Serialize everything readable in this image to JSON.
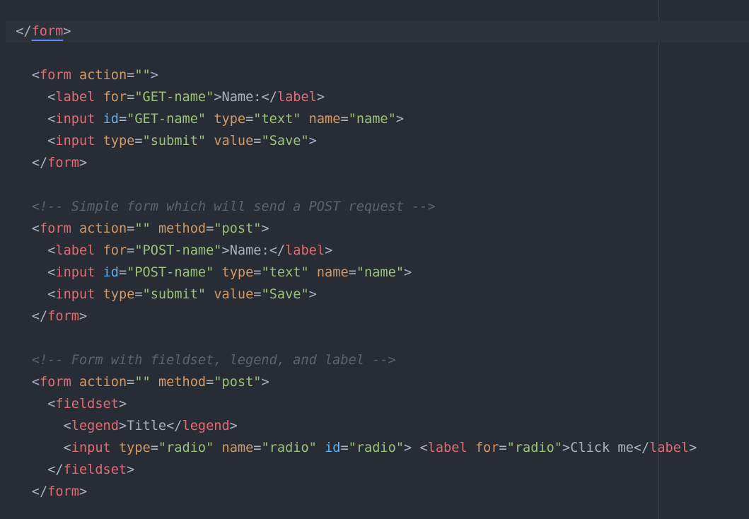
{
  "editor": {
    "colors": {
      "background": "#282c34",
      "current_line": "#2c313a",
      "punctuation": "#abb2bf",
      "tag": "#e06c75",
      "attribute": "#d19a66",
      "id_attribute": "#61afef",
      "string": "#98c379",
      "comment": "#5c6370",
      "bracket_match_underline": "#528bff"
    },
    "lines": [
      {
        "current": true,
        "tokens": [
          [
            "punc",
            "  </"
          ],
          [
            "tag",
            "form",
            "matched"
          ],
          [
            "punc",
            ">"
          ]
        ]
      },
      {
        "tokens": []
      },
      {
        "tokens": [
          [
            "punc",
            "    <"
          ],
          [
            "tag",
            "form"
          ],
          [
            "text",
            " "
          ],
          [
            "attr",
            "action"
          ],
          [
            "punc",
            "="
          ],
          [
            "str",
            "\"\""
          ],
          [
            "punc",
            ">"
          ]
        ]
      },
      {
        "tokens": [
          [
            "punc",
            "      <"
          ],
          [
            "tag",
            "label"
          ],
          [
            "text",
            " "
          ],
          [
            "attr",
            "for"
          ],
          [
            "punc",
            "="
          ],
          [
            "str",
            "\"GET-name\""
          ],
          [
            "punc",
            ">"
          ],
          [
            "text",
            "Name:"
          ],
          [
            "punc",
            "</"
          ],
          [
            "tag",
            "label"
          ],
          [
            "punc",
            ">"
          ]
        ]
      },
      {
        "tokens": [
          [
            "punc",
            "      <"
          ],
          [
            "tag",
            "input"
          ],
          [
            "text",
            " "
          ],
          [
            "id",
            "id"
          ],
          [
            "punc",
            "="
          ],
          [
            "str",
            "\"GET-name\""
          ],
          [
            "text",
            " "
          ],
          [
            "attr",
            "type"
          ],
          [
            "punc",
            "="
          ],
          [
            "str",
            "\"text\""
          ],
          [
            "text",
            " "
          ],
          [
            "attr",
            "name"
          ],
          [
            "punc",
            "="
          ],
          [
            "str",
            "\"name\""
          ],
          [
            "punc",
            ">"
          ]
        ]
      },
      {
        "tokens": [
          [
            "punc",
            "      <"
          ],
          [
            "tag",
            "input"
          ],
          [
            "text",
            " "
          ],
          [
            "attr",
            "type"
          ],
          [
            "punc",
            "="
          ],
          [
            "str",
            "\"submit\""
          ],
          [
            "text",
            " "
          ],
          [
            "attr",
            "value"
          ],
          [
            "punc",
            "="
          ],
          [
            "str",
            "\"Save\""
          ],
          [
            "punc",
            ">"
          ]
        ]
      },
      {
        "tokens": [
          [
            "punc",
            "    </"
          ],
          [
            "tag",
            "form"
          ],
          [
            "punc",
            ">"
          ]
        ]
      },
      {
        "tokens": []
      },
      {
        "tokens": [
          [
            "comment",
            "    <!-- Simple form which will send a POST request -->"
          ]
        ]
      },
      {
        "tokens": [
          [
            "punc",
            "    <"
          ],
          [
            "tag",
            "form"
          ],
          [
            "text",
            " "
          ],
          [
            "attr",
            "action"
          ],
          [
            "punc",
            "="
          ],
          [
            "str",
            "\"\""
          ],
          [
            "text",
            " "
          ],
          [
            "attr",
            "method"
          ],
          [
            "punc",
            "="
          ],
          [
            "str",
            "\"post\""
          ],
          [
            "punc",
            ">"
          ]
        ]
      },
      {
        "tokens": [
          [
            "punc",
            "      <"
          ],
          [
            "tag",
            "label"
          ],
          [
            "text",
            " "
          ],
          [
            "attr",
            "for"
          ],
          [
            "punc",
            "="
          ],
          [
            "str",
            "\"POST-name\""
          ],
          [
            "punc",
            ">"
          ],
          [
            "text",
            "Name:"
          ],
          [
            "punc",
            "</"
          ],
          [
            "tag",
            "label"
          ],
          [
            "punc",
            ">"
          ]
        ]
      },
      {
        "tokens": [
          [
            "punc",
            "      <"
          ],
          [
            "tag",
            "input"
          ],
          [
            "text",
            " "
          ],
          [
            "id",
            "id"
          ],
          [
            "punc",
            "="
          ],
          [
            "str",
            "\"POST-name\""
          ],
          [
            "text",
            " "
          ],
          [
            "attr",
            "type"
          ],
          [
            "punc",
            "="
          ],
          [
            "str",
            "\"text\""
          ],
          [
            "text",
            " "
          ],
          [
            "attr",
            "name"
          ],
          [
            "punc",
            "="
          ],
          [
            "str",
            "\"name\""
          ],
          [
            "punc",
            ">"
          ]
        ]
      },
      {
        "tokens": [
          [
            "punc",
            "      <"
          ],
          [
            "tag",
            "input"
          ],
          [
            "text",
            " "
          ],
          [
            "attr",
            "type"
          ],
          [
            "punc",
            "="
          ],
          [
            "str",
            "\"submit\""
          ],
          [
            "text",
            " "
          ],
          [
            "attr",
            "value"
          ],
          [
            "punc",
            "="
          ],
          [
            "str",
            "\"Save\""
          ],
          [
            "punc",
            ">"
          ]
        ]
      },
      {
        "tokens": [
          [
            "punc",
            "    </"
          ],
          [
            "tag",
            "form"
          ],
          [
            "punc",
            ">"
          ]
        ]
      },
      {
        "tokens": []
      },
      {
        "tokens": [
          [
            "comment",
            "    <!-- Form with fieldset, legend, and label -->"
          ]
        ]
      },
      {
        "tokens": [
          [
            "punc",
            "    <"
          ],
          [
            "tag",
            "form"
          ],
          [
            "text",
            " "
          ],
          [
            "attr",
            "action"
          ],
          [
            "punc",
            "="
          ],
          [
            "str",
            "\"\""
          ],
          [
            "text",
            " "
          ],
          [
            "attr",
            "method"
          ],
          [
            "punc",
            "="
          ],
          [
            "str",
            "\"post\""
          ],
          [
            "punc",
            ">"
          ]
        ]
      },
      {
        "tokens": [
          [
            "punc",
            "      <"
          ],
          [
            "tag",
            "fieldset"
          ],
          [
            "punc",
            ">"
          ]
        ]
      },
      {
        "tokens": [
          [
            "punc",
            "        <"
          ],
          [
            "tag",
            "legend"
          ],
          [
            "punc",
            ">"
          ],
          [
            "text",
            "Title"
          ],
          [
            "punc",
            "</"
          ],
          [
            "tag",
            "legend"
          ],
          [
            "punc",
            ">"
          ]
        ]
      },
      {
        "tokens": [
          [
            "punc",
            "        <"
          ],
          [
            "tag",
            "input"
          ],
          [
            "text",
            " "
          ],
          [
            "attr",
            "type"
          ],
          [
            "punc",
            "="
          ],
          [
            "str",
            "\"radio\""
          ],
          [
            "text",
            " "
          ],
          [
            "attr",
            "name"
          ],
          [
            "punc",
            "="
          ],
          [
            "str",
            "\"radio\""
          ],
          [
            "text",
            " "
          ],
          [
            "id",
            "id"
          ],
          [
            "punc",
            "="
          ],
          [
            "str",
            "\"radio\""
          ],
          [
            "punc",
            ">"
          ],
          [
            "text",
            " "
          ],
          [
            "punc",
            "<"
          ],
          [
            "tag",
            "label"
          ],
          [
            "text",
            " "
          ],
          [
            "attr",
            "for"
          ],
          [
            "punc",
            "="
          ],
          [
            "str",
            "\"radio\""
          ],
          [
            "punc",
            ">"
          ],
          [
            "text",
            "Click me"
          ],
          [
            "punc",
            "</"
          ],
          [
            "tag",
            "label"
          ],
          [
            "punc",
            ">"
          ]
        ]
      },
      {
        "tokens": [
          [
            "punc",
            "      </"
          ],
          [
            "tag",
            "fieldset"
          ],
          [
            "punc",
            ">"
          ]
        ]
      },
      {
        "tokens": [
          [
            "punc",
            "    </"
          ],
          [
            "tag",
            "form"
          ],
          [
            "punc",
            ">"
          ]
        ]
      }
    ]
  }
}
